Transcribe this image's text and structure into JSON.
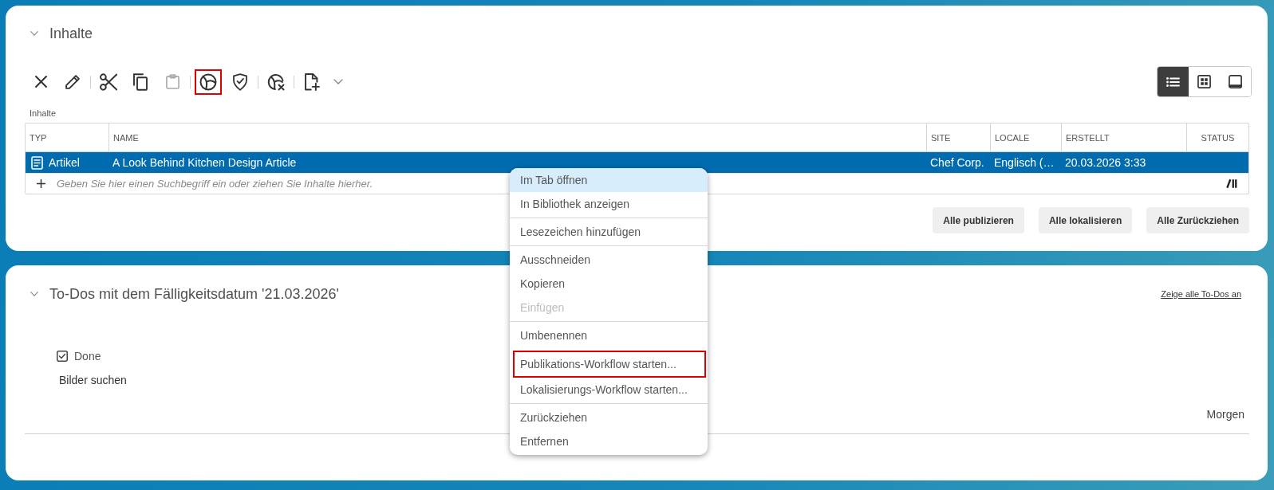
{
  "contents_panel": {
    "title": "Inhalte",
    "expanded": true,
    "toolbar": [
      {
        "buttons": [
          {
            "disabled": false,
            "highlighted": false
          },
          {
            "disabled": false,
            "highlighted": false
          }
        ]
      },
      {
        "buttons": [
          {
            "disabled": false,
            "highlighted": false
          },
          {
            "disabled": false,
            "highlighted": false
          },
          {
            "disabled": true,
            "highlighted": false
          }
        ]
      },
      {
        "buttons": [
          {
            "disabled": false,
            "highlighted": true
          },
          {
            "disabled": false,
            "highlighted": false
          }
        ]
      },
      {
        "buttons": [
          {
            "disabled": false,
            "highlighted": false
          }
        ]
      },
      {
        "buttons": [
          {
            "disabled": false,
            "highlighted": false
          },
          {
            "disabled": false,
            "highlighted": false
          }
        ]
      }
    ],
    "view_switcher": [
      {
        "selected": true
      },
      {
        "selected": false
      },
      {
        "selected": false
      }
    ],
    "list_label": "Inhalte",
    "table": {
      "columns": [
        "TYP",
        "NAME",
        "SITE",
        "LOCALE",
        "ERSTELLT",
        "STATUS"
      ],
      "rows": [
        {
          "selected": true,
          "cells": [
            "Artikel",
            "A Look Behind Kitchen Design Article",
            "Chef Corp.",
            "Englisch (…",
            "20.03.2026 3:33"
          ]
        }
      ],
      "add_row": {
        "placeholder": "Geben Sie hier einen Suchbegriff ein oder ziehen Sie Inhalte hierher."
      }
    },
    "buttons": [
      "Alle publizieren",
      "Alle lokalisieren",
      "Alle Zurückziehen"
    ]
  },
  "todos_panel": {
    "title": "To-Dos mit dem Fälligkeitsdatum '21.03.2026'",
    "expanded": true,
    "link": "Zeige alle To-Dos an",
    "items": [
      {
        "status": "Done",
        "checked": true,
        "title": "Bilder suchen",
        "due": "Morgen"
      }
    ]
  },
  "context_menu": {
    "groups": [
      {
        "items": [
          {
            "label": "Im Tab öffnen",
            "selected": true,
            "disabled": false,
            "highlighted": false
          },
          {
            "label": "In Bibliothek anzeigen",
            "selected": false,
            "disabled": false,
            "highlighted": false
          }
        ]
      },
      {
        "items": [
          {
            "label": "Lesezeichen hinzufügen",
            "selected": false,
            "disabled": false,
            "highlighted": false
          }
        ]
      },
      {
        "items": [
          {
            "label": "Ausschneiden",
            "selected": false,
            "disabled": false,
            "highlighted": false
          },
          {
            "label": "Kopieren",
            "selected": false,
            "disabled": false,
            "highlighted": false
          },
          {
            "label": "Einfügen",
            "selected": false,
            "disabled": true,
            "highlighted": false
          }
        ]
      },
      {
        "items": [
          {
            "label": "Umbenennen",
            "selected": false,
            "disabled": false,
            "highlighted": false
          },
          {
            "label": "Publikations-Workflow starten...",
            "selected": false,
            "disabled": false,
            "highlighted": true
          },
          {
            "label": "Lokalisierungs-Workflow starten...",
            "selected": false,
            "disabled": false,
            "highlighted": false
          }
        ]
      },
      {
        "items": [
          {
            "label": "Zurückziehen",
            "selected": false,
            "disabled": false,
            "highlighted": false
          },
          {
            "label": "Entfernen",
            "selected": false,
            "disabled": false,
            "highlighted": false
          }
        ]
      }
    ]
  }
}
